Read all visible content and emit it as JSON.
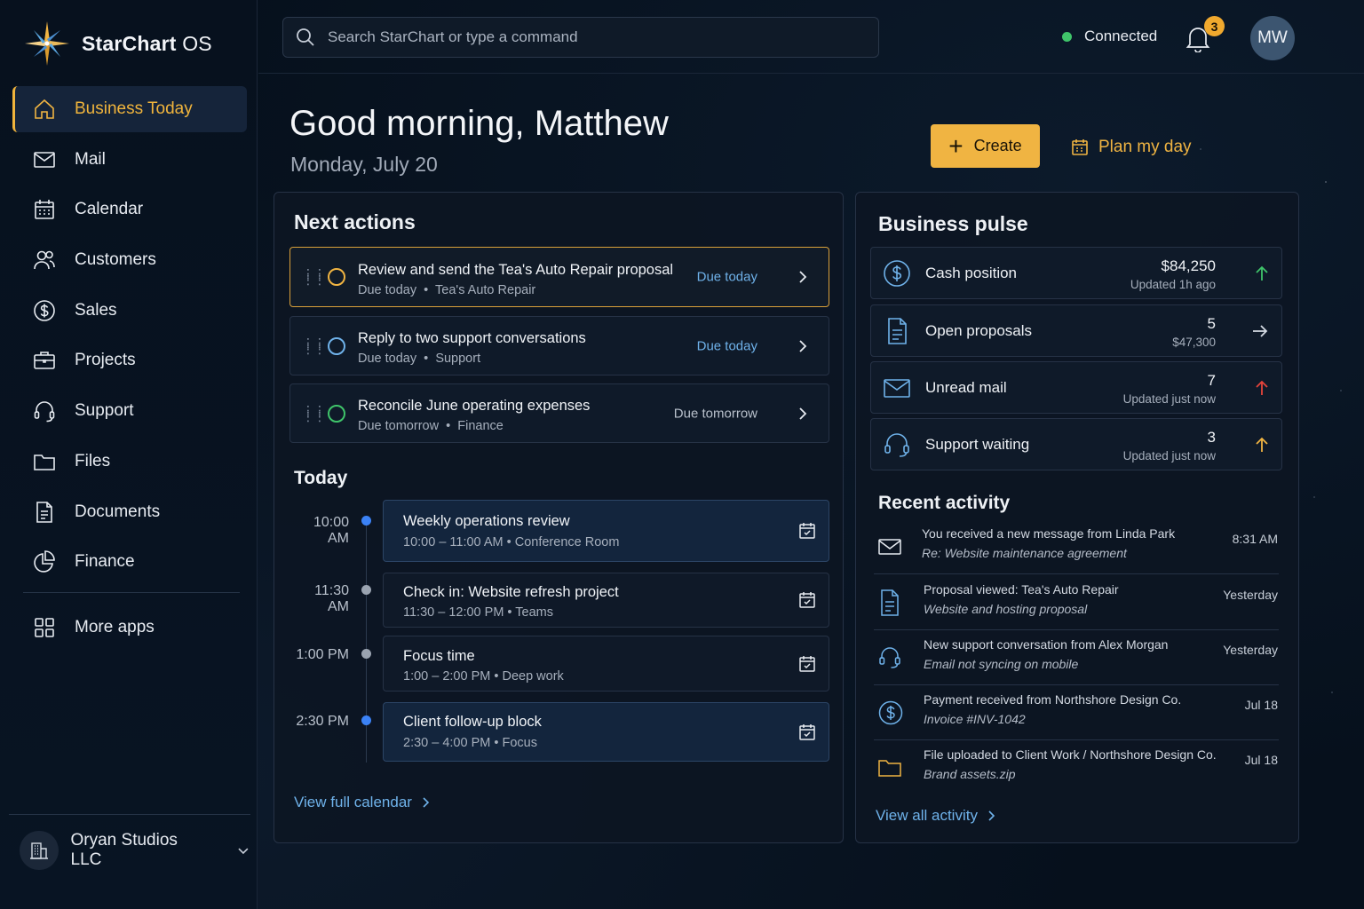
{
  "app": {
    "name": "StarChart",
    "name_suffix": "OS"
  },
  "sidebar": {
    "items": [
      {
        "label": "Business Today",
        "icon": "home-icon",
        "active": true
      },
      {
        "label": "Mail",
        "icon": "mail-icon"
      },
      {
        "label": "Calendar",
        "icon": "calendar-icon"
      },
      {
        "label": "Customers",
        "icon": "people-icon"
      },
      {
        "label": "Sales",
        "icon": "dollar-icon"
      },
      {
        "label": "Projects",
        "icon": "briefcase-icon"
      },
      {
        "label": "Support",
        "icon": "headset-icon"
      },
      {
        "label": "Files",
        "icon": "folder-icon"
      },
      {
        "label": "Documents",
        "icon": "document-icon"
      },
      {
        "label": "Finance",
        "icon": "pie-chart-icon"
      }
    ],
    "more_apps": "More apps",
    "org": "Oryan Studios LLC"
  },
  "topbar": {
    "search_placeholder": "Search StarChart or type a command",
    "status": "Connected",
    "notifications": "3",
    "avatar": "MW"
  },
  "header": {
    "greeting": "Good morning, Matthew",
    "date": "Monday, July 20",
    "create_label": "Create",
    "plan_label": "Plan my day"
  },
  "next_actions": {
    "title": "Next actions",
    "items": [
      {
        "title": "Review and send the Tea's Auto Repair proposal",
        "due_sub": "Due today",
        "context": "Tea's Auto Repair",
        "due": "Due today"
      },
      {
        "title": "Reply to two support conversations",
        "due_sub": "Due today",
        "context": "Support",
        "due": "Due today"
      },
      {
        "title": "Reconcile June operating expenses",
        "due_sub": "Due tomorrow",
        "context": "Finance",
        "due": "Due tomorrow"
      }
    ],
    "today_title": "Today",
    "events": [
      {
        "time": "10:00 AM",
        "title": "Weekly operations review",
        "detail": "10:00 – 11:00 AM • Conference Room"
      },
      {
        "time": "11:30 AM",
        "title": "Check in: Website refresh project",
        "detail": "11:30 – 12:00 PM • Teams"
      },
      {
        "time": "1:00 PM",
        "title": "Focus time",
        "detail": "1:00 – 2:00 PM • Deep work"
      },
      {
        "time": "2:30 PM",
        "title": "Client follow-up block",
        "detail": "2:30 – 4:00 PM • Focus"
      }
    ],
    "view_calendar": "View full calendar"
  },
  "pulse": {
    "title": "Business pulse",
    "rows": [
      {
        "label": "Cash position",
        "value": "$84,250",
        "sub": "Updated 1h ago",
        "trend": "up",
        "trend_color": "#3fc46a"
      },
      {
        "label": "Open proposals",
        "value": "5",
        "sub": "$47,300",
        "trend": "right",
        "trend_color": "#d5dbe4"
      },
      {
        "label": "Unread mail",
        "value": "7",
        "sub": "Updated just now",
        "trend": "up",
        "trend_color": "#e5443b"
      },
      {
        "label": "Support waiting",
        "value": "3",
        "sub": "Updated just now",
        "trend": "up",
        "trend_color": "#f0b442"
      }
    ],
    "recent_title": "Recent activity",
    "activity": [
      {
        "icon": "mail-icon",
        "line1": "You received a new message from Linda Park",
        "line2": "Re: Website maintenance agreement",
        "time": "8:31 AM"
      },
      {
        "icon": "document-icon",
        "line1": "Proposal viewed: Tea's Auto Repair",
        "line2": "Website and hosting proposal",
        "time": "Yesterday"
      },
      {
        "icon": "headset-icon",
        "line1": "New support conversation from Alex Morgan",
        "line2": "Email not syncing on mobile",
        "time": "Yesterday"
      },
      {
        "icon": "dollar-icon",
        "line1": "Payment received from Northshore Design Co.",
        "line2": "Invoice #INV-1042",
        "time": "Jul 18"
      },
      {
        "icon": "folder-icon",
        "line1": "File uploaded to Client Work / Northshore Design Co.",
        "line2": "Brand assets.zip",
        "time": "Jul 18"
      }
    ],
    "view_activity": "View all activity"
  },
  "colors": {
    "accent": "#f0b442",
    "link": "#6fb2ea",
    "background": "#06101c",
    "card": "#0d1623"
  }
}
